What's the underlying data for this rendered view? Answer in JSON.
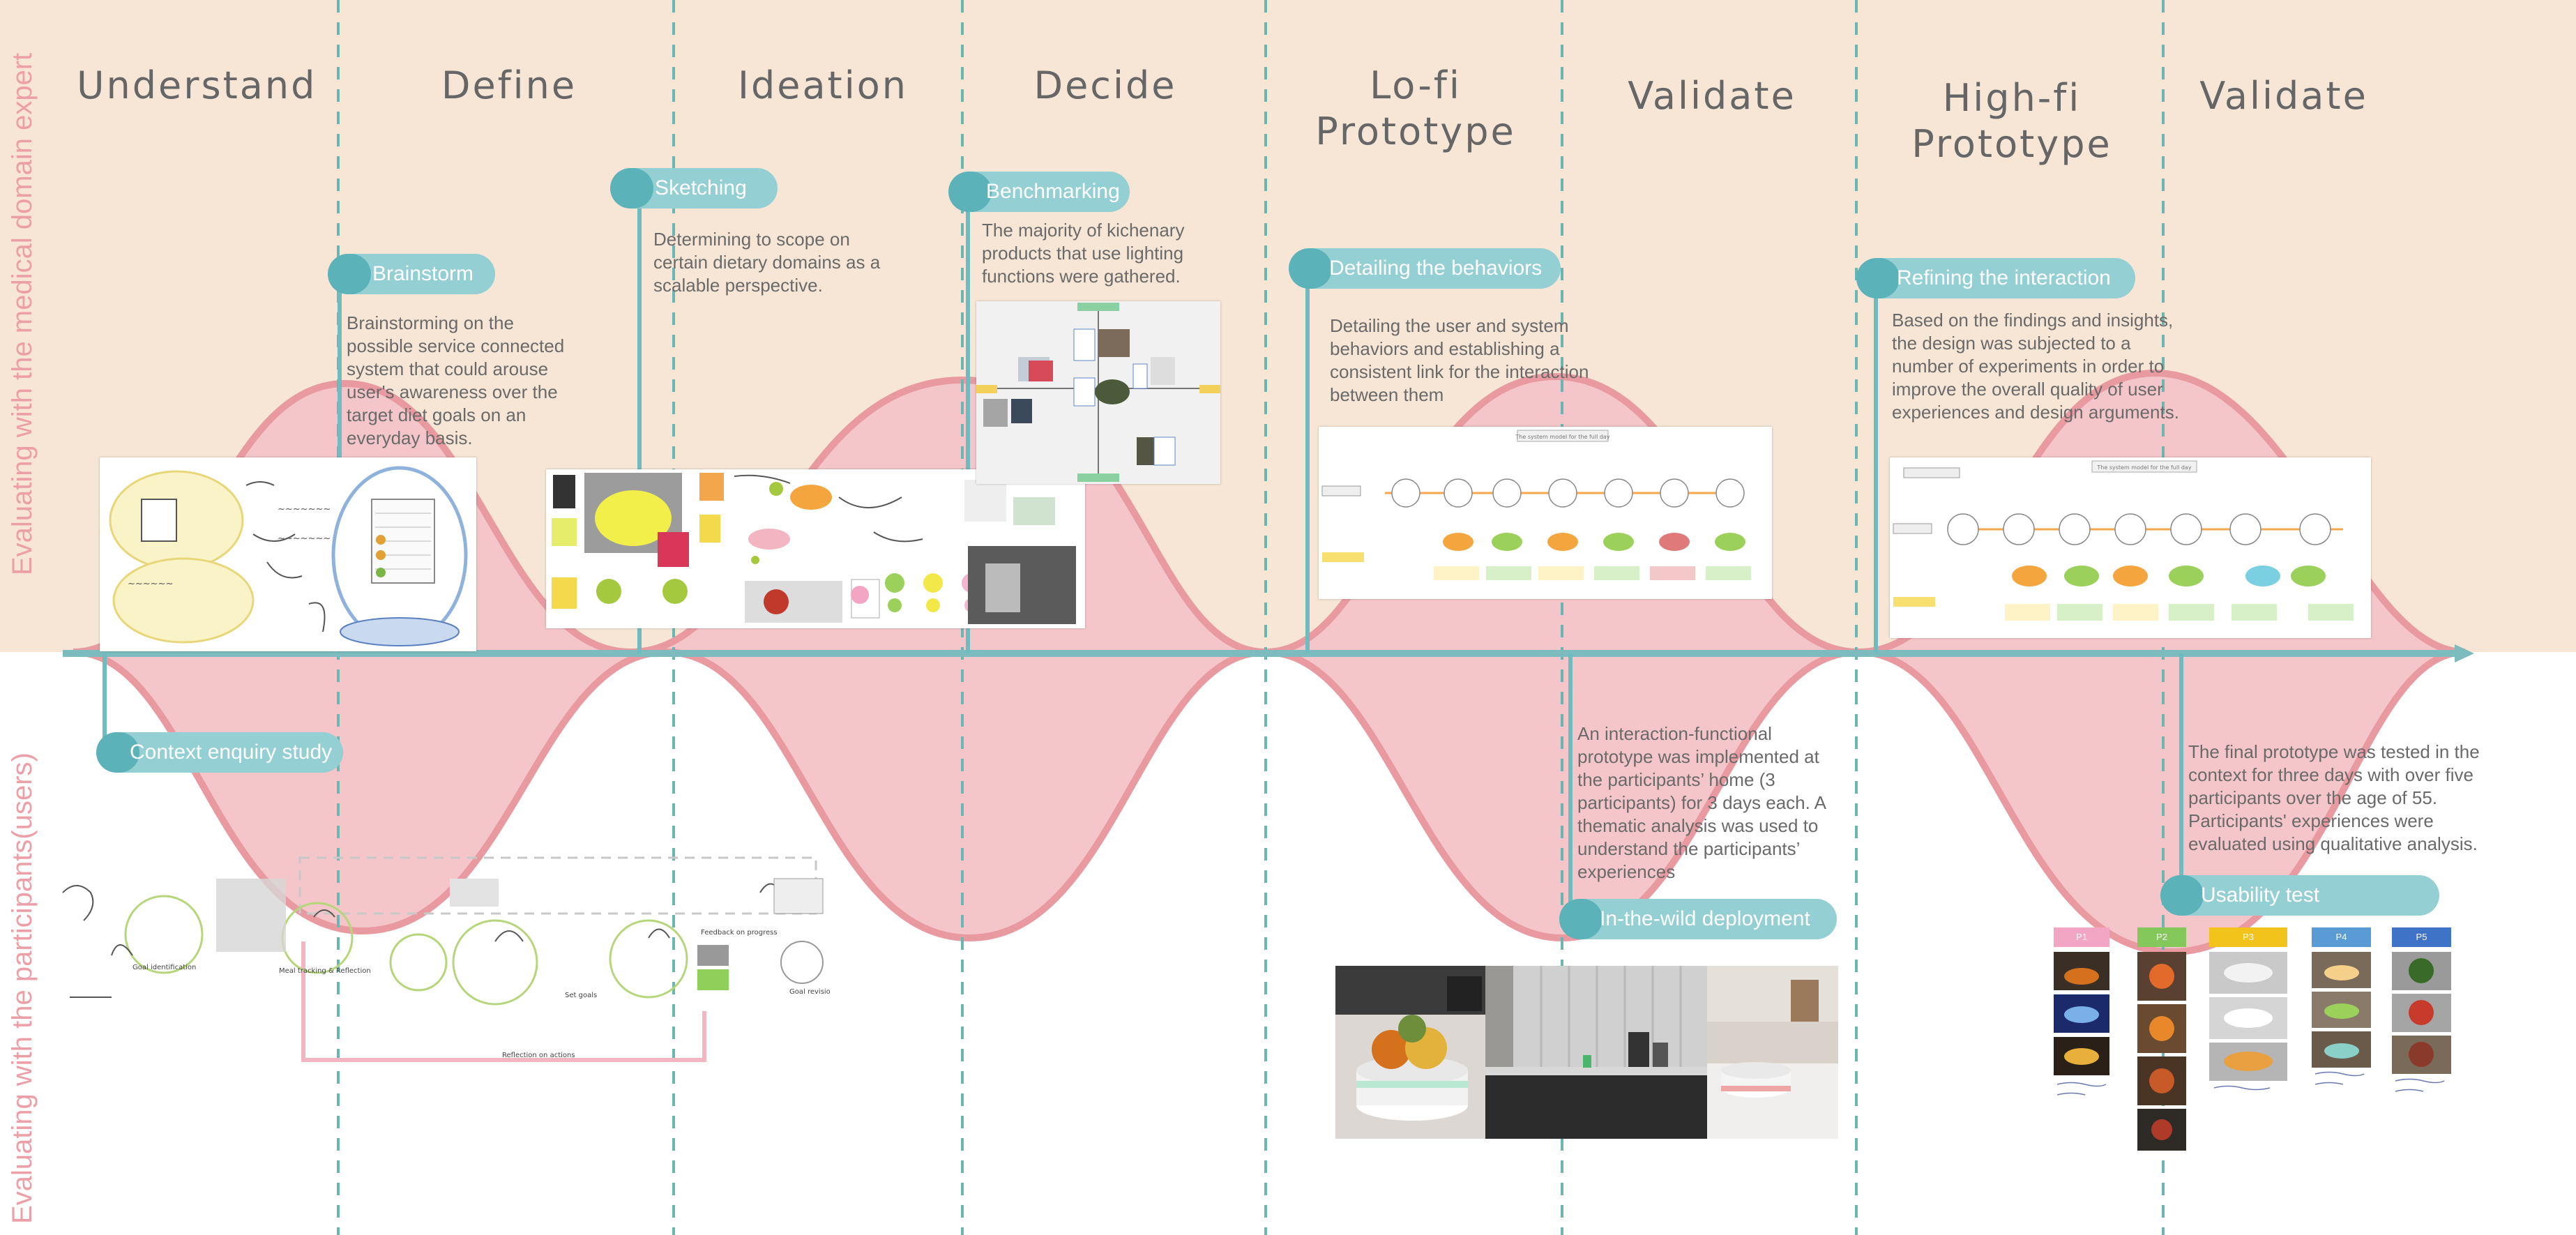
{
  "colors": {
    "top_band": "#f7e6d5",
    "wave_fill": "#f4c6c9",
    "wave_stroke": "#e89aa0",
    "axis": "#7cbcbe",
    "divider": "#6bb5b3",
    "pill_fill": "#93cfd3",
    "pill_cap": "#5bb3b9",
    "side_label": "#ec9fa6",
    "phase_text": "#666666"
  },
  "side_labels": {
    "top": "Evaluating with the medical domain expert",
    "bottom": "Evaluating with the participants(users)"
  },
  "phases": [
    {
      "label": "Understand"
    },
    {
      "label": "Define"
    },
    {
      "label": "Ideation"
    },
    {
      "label": "Decide"
    },
    {
      "label": "Lo-fi Prototype"
    },
    {
      "label": "Validate"
    },
    {
      "label": "High-fi\nPrototype"
    },
    {
      "label": "Validate"
    }
  ],
  "steps": {
    "brainstorm": {
      "label": "Brainstorm",
      "desc": "Brainstorming on the possible service connected system that could arouse user's awareness over the target diet goals on an everyday basis."
    },
    "sketching": {
      "label": "Sketching",
      "desc": "Determining to scope on certain dietary domains as a scalable perspective."
    },
    "benchmarking": {
      "label": "Benchmarking",
      "desc": "The majority of kichenary products that use lighting functions were gathered."
    },
    "detailing": {
      "label": "Detailing the behaviors",
      "desc": "Detailing the user and system behaviors and establishing a consistent link for the interaction between them"
    },
    "refining": {
      "label": "Refining the interaction",
      "desc": "Based on the findings and insights, the design was subjected to a number of experiments in order to improve the overall quality of user experiences and design arguments."
    },
    "context": {
      "label": "Context enquiry study"
    },
    "inthewild": {
      "label": "In-the-wild deployment",
      "desc": "An interaction-functional prototype was implemented at the participants’ home (3 participants) for 3 days each. A thematic analysis was used to understand the participants’ experiences"
    },
    "usability": {
      "label": "Usability test",
      "desc": "The final prototype was tested in the context for three days with over five participants over the age of 55. Participants' experiences were evaluated using qualitative analysis."
    }
  },
  "sketch_labels": {
    "goal_identification": "Goal identification",
    "meal_tracking": "Meal tracking & Reflection",
    "set_goals": "Set goals",
    "feedback": "Feedback on progress",
    "goal_revision": "Goal revision",
    "reflection_on_actions": "Reflection on actions"
  },
  "usability_columns": [
    {
      "label": "P1",
      "color": "#f3a6c4"
    },
    {
      "label": "P2",
      "color": "#84c75a"
    },
    {
      "label": "P3",
      "color": "#f2c31b"
    },
    {
      "label": "P4",
      "color": "#5b9bd5"
    },
    {
      "label": "P5",
      "color": "#3f73c8"
    }
  ],
  "flow_titles": {
    "lofi": "The system model for the full day",
    "hifi": "The system model for the full day"
  }
}
